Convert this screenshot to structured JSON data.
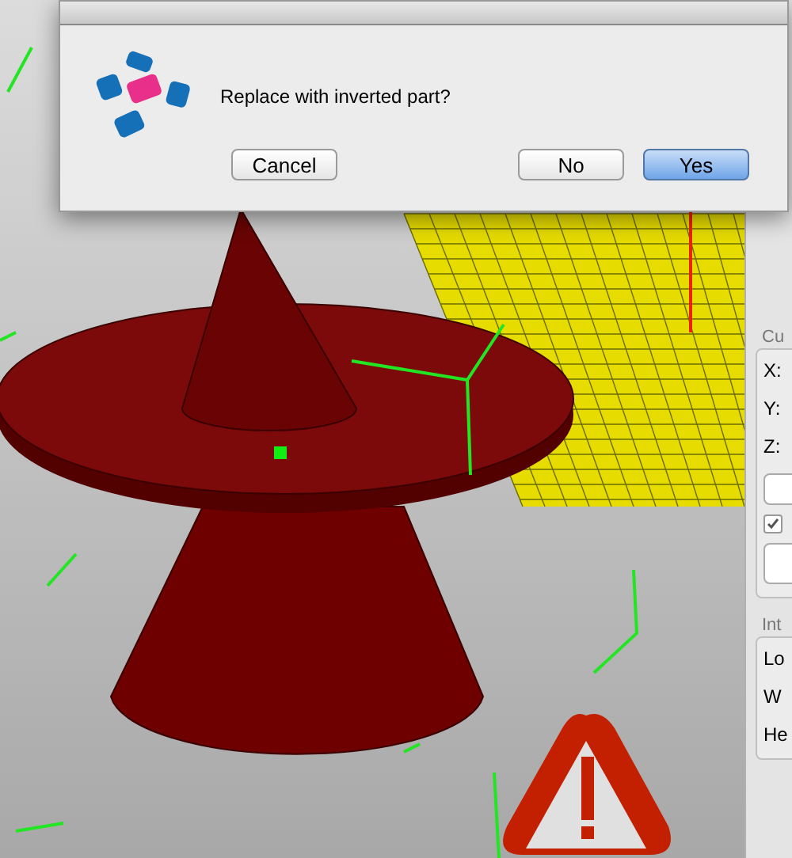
{
  "dialog": {
    "message": "Replace with inverted part?",
    "buttons": [
      {
        "label": "Cancel",
        "default": false
      },
      {
        "label": "No",
        "default": false
      },
      {
        "label": "Yes",
        "default": true
      }
    ]
  },
  "side_panel": {
    "groups": [
      {
        "title": "Cu",
        "fields": [
          "X:",
          "Y:",
          "Z:"
        ],
        "checkbox": {
          "checked": true
        }
      },
      {
        "title": "Int",
        "fields": [
          "Lo",
          "W",
          "He"
        ]
      }
    ]
  }
}
